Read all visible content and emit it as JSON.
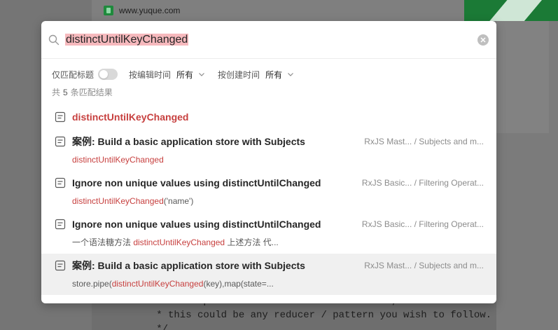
{
  "background": {
    "url": "www.yuque.com",
    "code_lines": [
      "   * with updated state and emit the result, however",
      "   * this could be any reducer / pattern you wish to follow.",
      "   */"
    ]
  },
  "search": {
    "query": "distinctUntilKeyChanged"
  },
  "filters": {
    "title_only_label": "仅匹配标题",
    "edit_time_label": "按编辑时间",
    "edit_time_value": "所有",
    "create_time_label": "按创建时间",
    "create_time_value": "所有"
  },
  "summary": {
    "prefix": "共",
    "count": "5",
    "suffix": "条匹配结果"
  },
  "results": [
    {
      "title": "distinctUntilKeyChanged",
      "title_highlight": true,
      "book": "",
      "chapter": "",
      "snippet_before": "",
      "snippet_match": "",
      "snippet_after": ""
    },
    {
      "title": "案例: Build a basic application store with Subjects",
      "book": "RxJS Mast...",
      "chapter": "/ Subjects and m...",
      "snippet_before": "",
      "snippet_match": "distinctUntilKeyChanged",
      "snippet_after": ""
    },
    {
      "title": "Ignore non unique values using distinctUntilChanged",
      "book": "RxJS Basic...",
      "chapter": "/ Filtering Operat...",
      "snippet_before": "",
      "snippet_match": "distinctUntilKeyChanged",
      "snippet_after": "('name')"
    },
    {
      "title": "Ignore non unique values using distinctUntilChanged",
      "book": "RxJS Basic...",
      "chapter": "/ Filtering Operat...",
      "snippet_before": "一个语法糖方法 ",
      "snippet_match": "distinctUntilKeyChanged",
      "snippet_after": " 上述方法 代..."
    },
    {
      "title": "案例: Build a basic application store with Subjects",
      "book": "RxJS Mast...",
      "chapter": "/ Subjects and m...",
      "snippet_before": "store.pipe(",
      "snippet_match": "distinctUntilKeyChanged",
      "snippet_after": "(key),map(state=..."
    }
  ],
  "colors": {
    "highlight_text": "#c7403f",
    "highlight_bg": "#f6b9bd",
    "selected_row": "#f0f0f0"
  }
}
